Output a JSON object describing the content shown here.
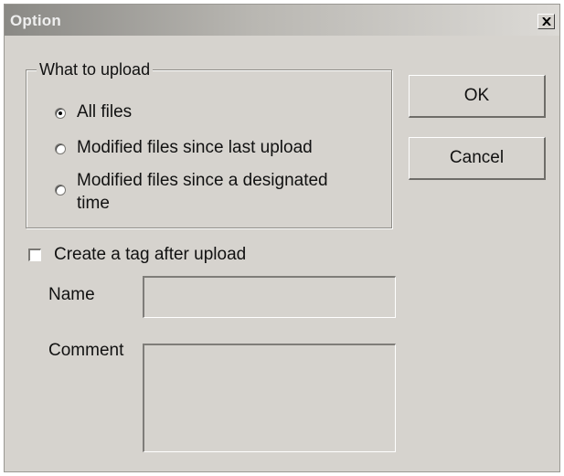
{
  "window": {
    "title": "Option",
    "close_glyph": "✕"
  },
  "upload_group": {
    "legend": "What to upload",
    "options": [
      {
        "label": "All files",
        "selected": true
      },
      {
        "label": "Modified files since last upload",
        "selected": false
      },
      {
        "label_line1": "Modified files since a designated",
        "label_line2": "time",
        "selected": false
      }
    ]
  },
  "buttons": {
    "ok_label": "OK",
    "cancel_label": "Cancel"
  },
  "tag": {
    "checkbox_label": "Create a tag after upload",
    "checked": false,
    "name_label": "Name",
    "name_value": "",
    "comment_label": "Comment",
    "comment_value": ""
  },
  "colors": {
    "dialog_bg": "#d6d3ce",
    "titlebar_start": "#8a8985",
    "titlebar_end": "#dcdad6"
  }
}
